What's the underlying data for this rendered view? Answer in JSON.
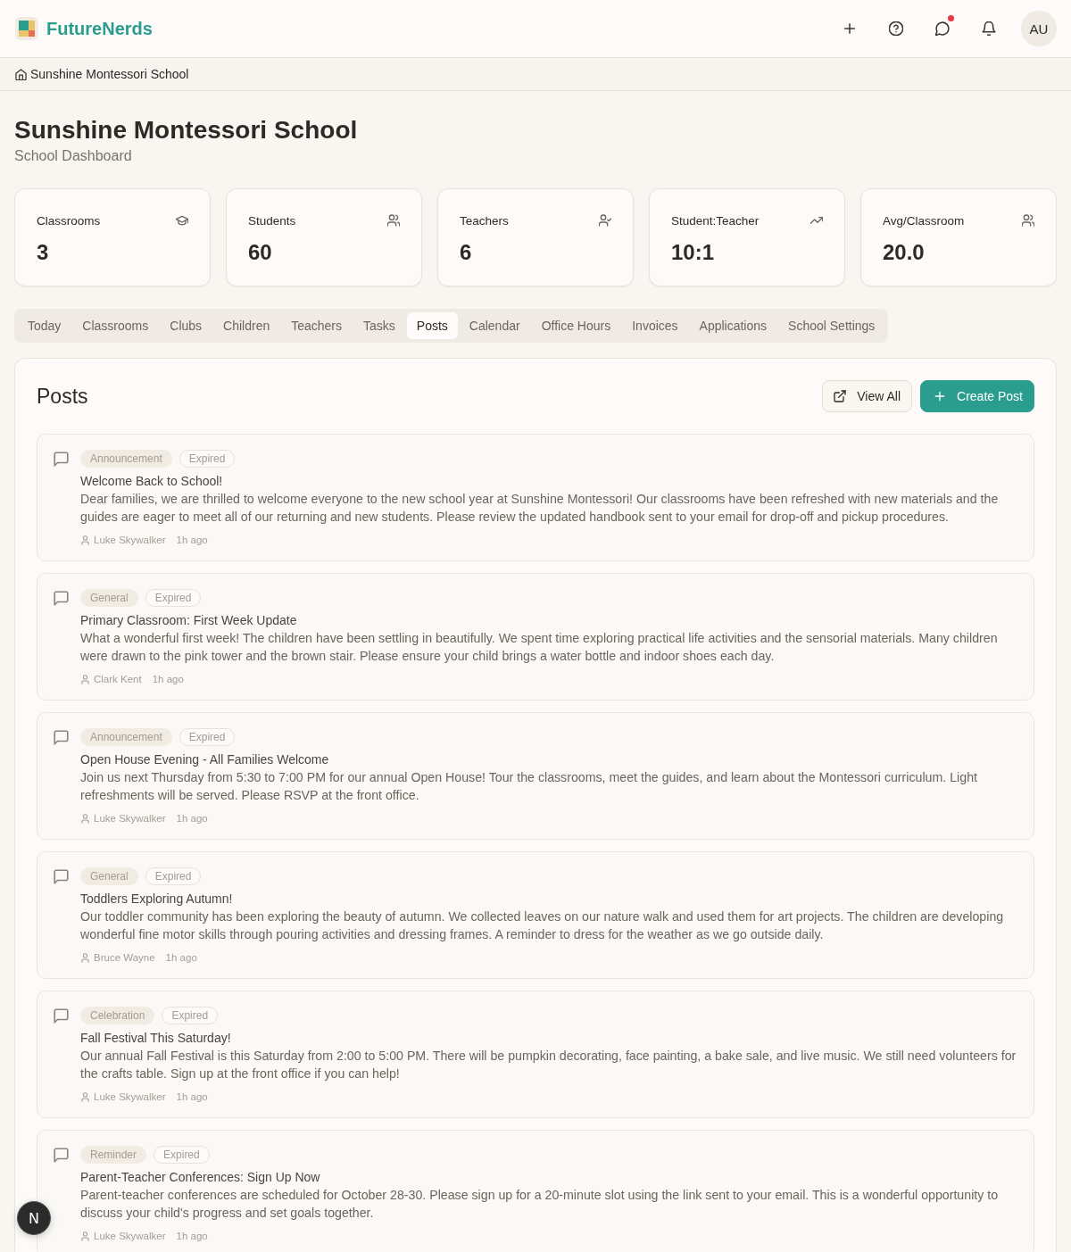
{
  "header": {
    "brand": "FutureNerds",
    "messages_unread": true,
    "avatar": "AU"
  },
  "breadcrumb": {
    "label": "Sunshine Montessori School"
  },
  "page": {
    "title": "Sunshine Montessori School",
    "subtitle": "School Dashboard"
  },
  "stats": [
    {
      "label": "Classrooms",
      "value": "3"
    },
    {
      "label": "Students",
      "value": "60"
    },
    {
      "label": "Teachers",
      "value": "6"
    },
    {
      "label": "Student:Teacher",
      "value": "10:1"
    },
    {
      "label": "Avg/Classroom",
      "value": "20.0"
    }
  ],
  "tabs": [
    {
      "label": "Today",
      "selected": false
    },
    {
      "label": "Classrooms",
      "selected": false
    },
    {
      "label": "Clubs",
      "selected": false
    },
    {
      "label": "Children",
      "selected": false
    },
    {
      "label": "Teachers",
      "selected": false
    },
    {
      "label": "Tasks",
      "selected": false
    },
    {
      "label": "Posts",
      "selected": true
    },
    {
      "label": "Calendar",
      "selected": false
    },
    {
      "label": "Office Hours",
      "selected": false
    },
    {
      "label": "Invoices",
      "selected": false
    },
    {
      "label": "Applications",
      "selected": false
    },
    {
      "label": "School Settings",
      "selected": false
    }
  ],
  "posts_panel": {
    "title": "Posts",
    "buttons": [
      {
        "label": "View All",
        "kind": "secondary"
      },
      {
        "label": "Create Post",
        "kind": "primary"
      }
    ],
    "posts": [
      {
        "category": "Announcement",
        "status": "Expired",
        "title": "Welcome Back to School!",
        "body": "Dear families, we are thrilled to welcome everyone to the new school year at Sunshine Montessori! Our classrooms have been refreshed with new materials and the guides are eager to meet all of our returning and new students. Please review the updated handbook sent to your email for drop-off and pickup procedures.",
        "author": "Luke Skywalker",
        "time": "1h ago"
      },
      {
        "category": "General",
        "status": "Expired",
        "title": "Primary Classroom: First Week Update",
        "body": "What a wonderful first week! The children have been settling in beautifully. We spent time exploring practical life activities and the sensorial materials. Many children were drawn to the pink tower and the brown stair. Please ensure your child brings a water bottle and indoor shoes each day.",
        "author": "Clark Kent",
        "time": "1h ago"
      },
      {
        "category": "Announcement",
        "status": "Expired",
        "title": "Open House Evening - All Families Welcome",
        "body": "Join us next Thursday from 5:30 to 7:00 PM for our annual Open House! Tour the classrooms, meet the guides, and learn about the Montessori curriculum. Light refreshments will be served. Please RSVP at the front office.",
        "author": "Luke Skywalker",
        "time": "1h ago"
      },
      {
        "category": "General",
        "status": "Expired",
        "title": "Toddlers Exploring Autumn!",
        "body": "Our toddler community has been exploring the beauty of autumn. We collected leaves on our nature walk and used them for art projects. The children are developing wonderful fine motor skills through pouring activities and dressing frames. A reminder to dress for the weather as we go outside daily.",
        "author": "Bruce Wayne",
        "time": "1h ago"
      },
      {
        "category": "Celebration",
        "status": "Expired",
        "title": "Fall Festival This Saturday!",
        "body": "Our annual Fall Festival is this Saturday from 2:00 to 5:00 PM. There will be pumpkin decorating, face painting, a bake sale, and live music. We still need volunteers for the crafts table. Sign up at the front office if you can help!",
        "author": "Luke Skywalker",
        "time": "1h ago"
      },
      {
        "category": "Reminder",
        "status": "Expired",
        "title": "Parent-Teacher Conferences: Sign Up Now",
        "body": "Parent-teacher conferences are scheduled for October 28-30. Please sign up for a 20-minute slot using the link sent to your email. This is a wonderful opportunity to discuss your child's progress and set goals together.",
        "author": "Luke Skywalker",
        "time": "1h ago"
      }
    ]
  },
  "dev_badge": {
    "label": "N"
  }
}
